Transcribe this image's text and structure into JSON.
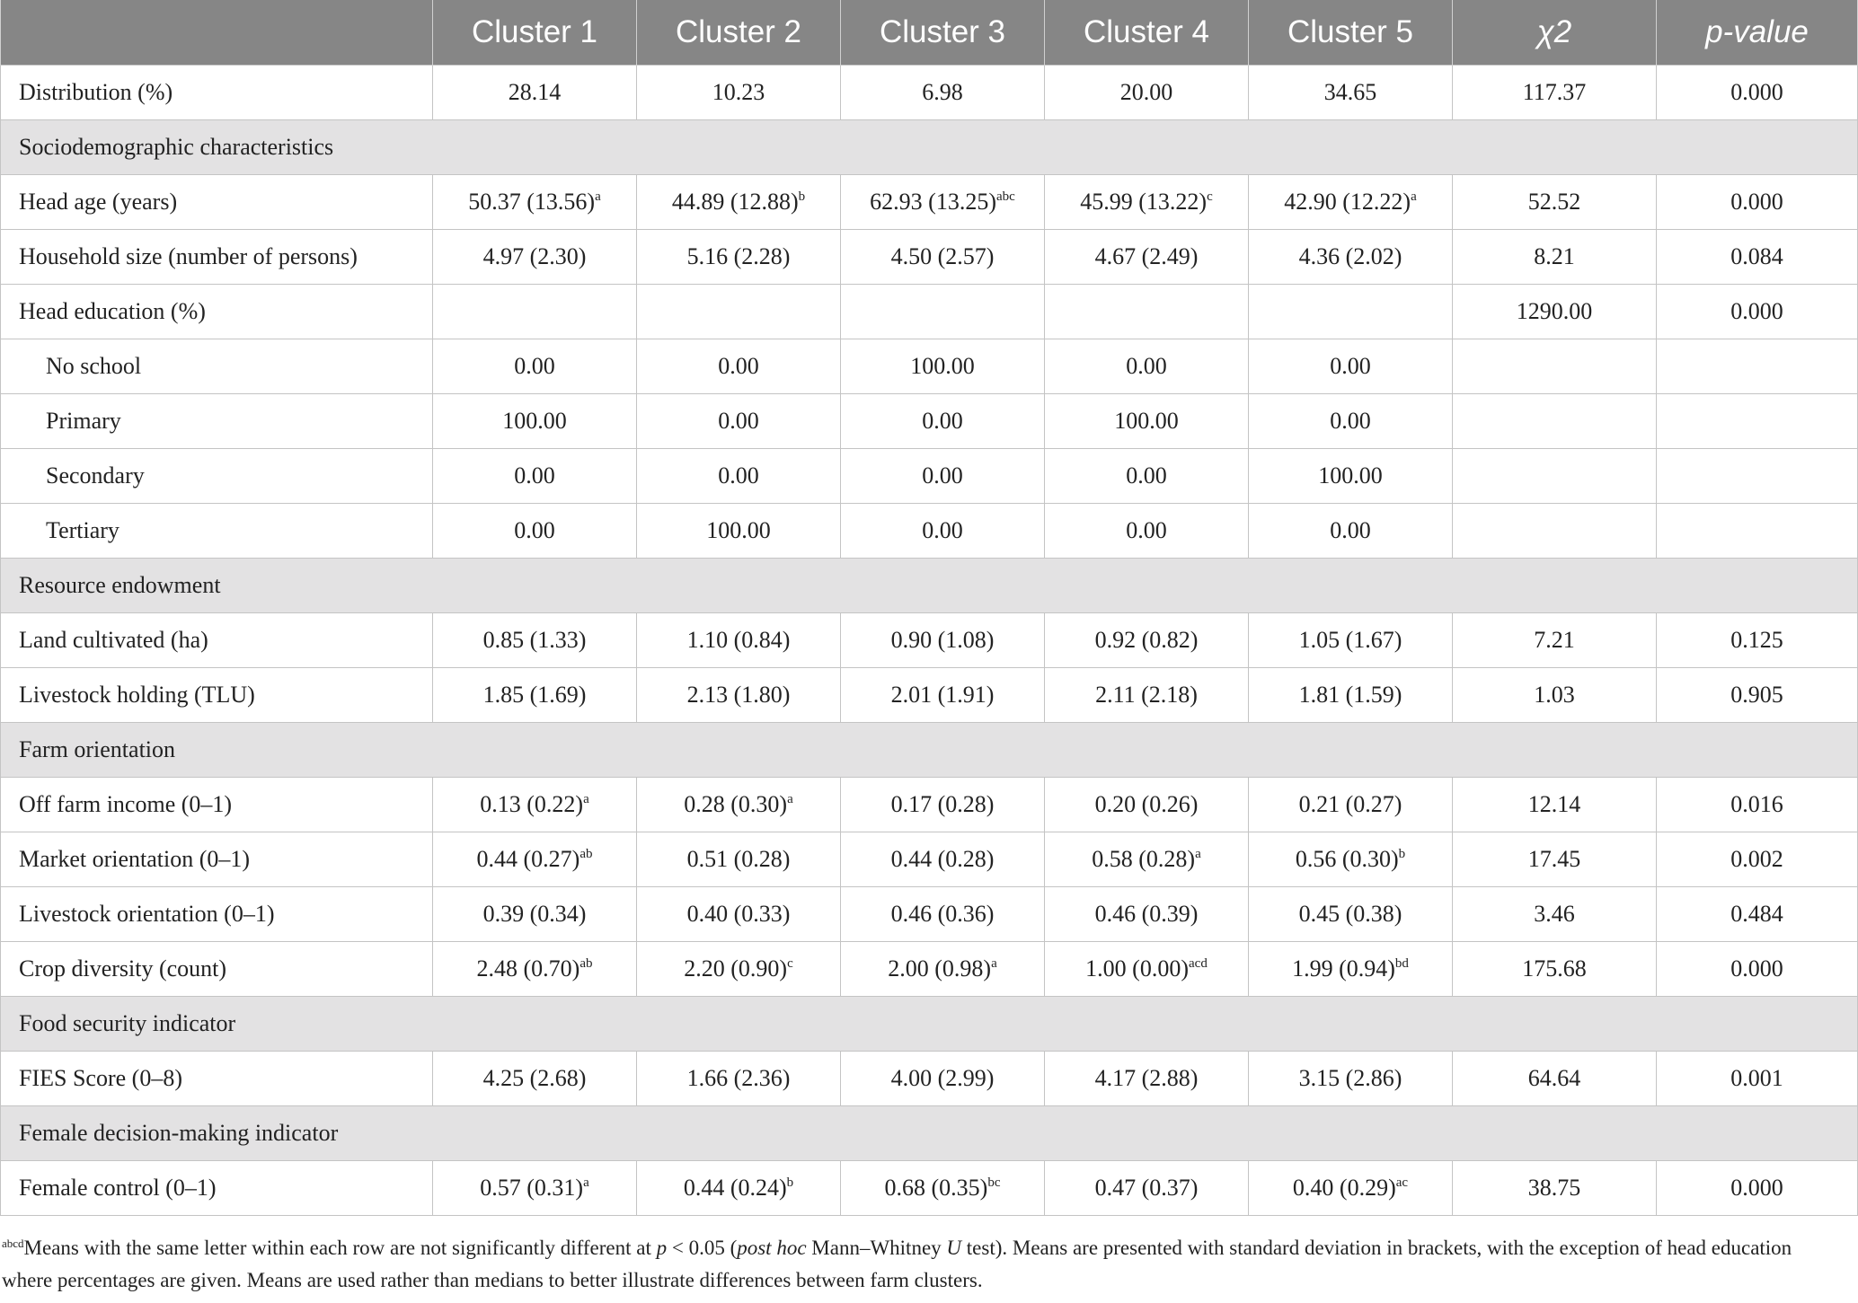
{
  "table": {
    "headers": [
      "",
      "Cluster 1",
      "Cluster 2",
      "Cluster 3",
      "Cluster 4",
      "Cluster 5",
      "χ2",
      "p-value"
    ],
    "rows": [
      {
        "type": "data",
        "label": "Distribution (%)",
        "cells": [
          "28.14",
          "10.23",
          "6.98",
          "20.00",
          "34.65",
          "117.37",
          "0.000"
        ]
      },
      {
        "type": "section",
        "label": "Sociodemographic characteristics"
      },
      {
        "type": "data",
        "label": "Head age (years)",
        "cells": [
          "50.37 (13.56)",
          "44.89 (12.88)",
          "62.93 (13.25)",
          "45.99 (13.22)",
          "42.90 (12.22)",
          "52.52",
          "0.000"
        ],
        "sups": [
          "a",
          "b",
          "abc",
          "c",
          "a",
          "",
          ""
        ]
      },
      {
        "type": "data",
        "label": "Household size (number of persons)",
        "cells": [
          "4.97 (2.30)",
          "5.16 (2.28)",
          "4.50 (2.57)",
          "4.67 (2.49)",
          "4.36 (2.02)",
          "8.21",
          "0.084"
        ]
      },
      {
        "type": "data",
        "label": "Head education (%)",
        "cells": [
          "",
          "",
          "",
          "",
          "",
          "1290.00",
          "0.000"
        ]
      },
      {
        "type": "data",
        "indent": true,
        "label": "No school",
        "cells": [
          "0.00",
          "0.00",
          "100.00",
          "0.00",
          "0.00",
          "",
          ""
        ]
      },
      {
        "type": "data",
        "indent": true,
        "label": "Primary",
        "cells": [
          "100.00",
          "0.00",
          "0.00",
          "100.00",
          "0.00",
          "",
          ""
        ]
      },
      {
        "type": "data",
        "indent": true,
        "label": "Secondary",
        "cells": [
          "0.00",
          "0.00",
          "0.00",
          "0.00",
          "100.00",
          "",
          ""
        ]
      },
      {
        "type": "data",
        "indent": true,
        "label": "Tertiary",
        "cells": [
          "0.00",
          "100.00",
          "0.00",
          "0.00",
          "0.00",
          "",
          ""
        ]
      },
      {
        "type": "section",
        "label": "Resource endowment"
      },
      {
        "type": "data",
        "label": "Land cultivated (ha)",
        "cells": [
          "0.85 (1.33)",
          "1.10 (0.84)",
          "0.90 (1.08)",
          "0.92 (0.82)",
          "1.05 (1.67)",
          "7.21",
          "0.125"
        ]
      },
      {
        "type": "data",
        "label": "Livestock holding (TLU)",
        "cells": [
          "1.85 (1.69)",
          "2.13 (1.80)",
          "2.01 (1.91)",
          "2.11 (2.18)",
          "1.81 (1.59)",
          "1.03",
          "0.905"
        ]
      },
      {
        "type": "section",
        "label": "Farm orientation"
      },
      {
        "type": "data",
        "label": "Off farm income (0–1)",
        "cells": [
          "0.13 (0.22)",
          "0.28 (0.30)",
          "0.17 (0.28)",
          "0.20 (0.26)",
          "0.21 (0.27)",
          "12.14",
          "0.016"
        ],
        "sups": [
          "a",
          "a",
          "",
          "",
          "",
          "",
          ""
        ]
      },
      {
        "type": "data",
        "label": "Market orientation (0–1)",
        "cells": [
          "0.44 (0.27)",
          "0.51 (0.28)",
          "0.44 (0.28)",
          "0.58 (0.28)",
          "0.56 (0.30)",
          "17.45",
          "0.002"
        ],
        "sups": [
          "ab",
          "",
          "",
          "a",
          "b",
          "",
          ""
        ]
      },
      {
        "type": "data",
        "label": "Livestock orientation (0–1)",
        "cells": [
          "0.39 (0.34)",
          "0.40 (0.33)",
          "0.46 (0.36)",
          "0.46 (0.39)",
          "0.45 (0.38)",
          "3.46",
          "0.484"
        ]
      },
      {
        "type": "data",
        "label": "Crop diversity (count)",
        "cells": [
          "2.48 (0.70)",
          "2.20 (0.90)",
          "2.00 (0.98)",
          "1.00 (0.00)",
          "1.99 (0.94)",
          "175.68",
          "0.000"
        ],
        "sups": [
          "ab",
          "c",
          "a",
          "acd",
          "bd",
          "",
          ""
        ]
      },
      {
        "type": "section",
        "label": "Food security indicator"
      },
      {
        "type": "data",
        "label": "FIES Score (0–8)",
        "cells": [
          "4.25 (2.68)",
          "1.66 (2.36)",
          "4.00 (2.99)",
          "4.17 (2.88)",
          "3.15 (2.86)",
          "64.64",
          "0.001"
        ]
      },
      {
        "type": "section",
        "label": "Female decision-making indicator"
      },
      {
        "type": "data",
        "label": "Female control (0–1)",
        "cells": [
          "0.57 (0.31)",
          "0.44 (0.24)",
          "0.68 (0.35)",
          "0.47 (0.37)",
          "0.40 (0.29)",
          "38.75",
          "0.000"
        ],
        "sups": [
          "a",
          "b",
          "bc",
          "",
          "ac",
          "",
          ""
        ]
      }
    ]
  },
  "footnote": {
    "sup": "abcd",
    "t1": "Means with the same letter within each row are not significantly different at ",
    "p": "p",
    "t2": " < 0.05 (",
    "posthoc": "post hoc",
    "t3": " Mann–Whitney ",
    "u": "U",
    "t4": " test). Means are presented with standard deviation in brackets, with the exception of head education where percentages are given. Means are used rather than medians to better illustrate differences between farm clusters."
  }
}
